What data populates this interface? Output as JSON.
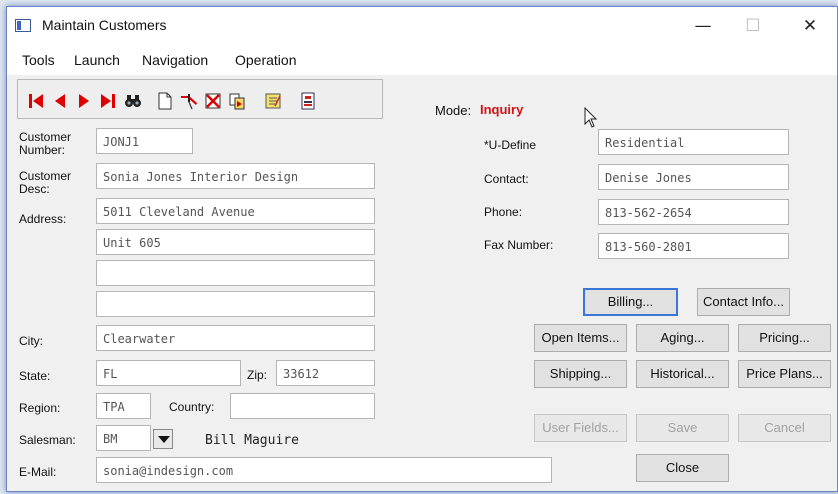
{
  "window": {
    "title": "Maintain Customers",
    "minimize": "—",
    "maximize": "☐",
    "close": "✕"
  },
  "menu": [
    "Tools",
    "Launch",
    "Navigation",
    "Operation"
  ],
  "toolbar_icons": [
    "first-record-icon",
    "previous-record-icon",
    "next-record-icon",
    "last-record-icon",
    "find-binoculars-icon",
    "new-record-icon",
    "pin-icon",
    "delete-icon",
    "copy-icon",
    "notes-icon",
    "report-icon"
  ],
  "mode": {
    "label": "Mode:",
    "value": "Inquiry",
    "color": "#d31212"
  },
  "labels": {
    "customer_number": "Customer Number:",
    "customer_desc": "Customer Desc:",
    "address": "Address:",
    "city": "City:",
    "state": "State:",
    "zip": "Zip:",
    "region": "Region:",
    "country": "Country:",
    "salesman": "Salesman:",
    "email": "E-Mail:",
    "udefine": "*U-Define",
    "contact": "Contact:",
    "phone": "Phone:",
    "fax": "Fax Number:"
  },
  "values": {
    "customer_number": "JONJ1",
    "customer_desc": "Sonia Jones Interior Design",
    "address1": "5011 Cleveland Avenue",
    "address2": "Unit 605",
    "address3": "",
    "address4": "",
    "city": "Clearwater",
    "state": "FL",
    "zip": "33612",
    "region": "TPA",
    "country": "",
    "salesman": "BM",
    "salesman_name": "Bill Maguire",
    "email": "sonia@indesign.com",
    "udefine": "Residential",
    "contact": "Denise Jones",
    "phone": "813-562-2654",
    "fax": "813-560-2801"
  },
  "buttons": {
    "billing": "Billing...",
    "contact_info": "Contact Info...",
    "open_items": "Open Items...",
    "aging": "Aging...",
    "pricing": "Pricing...",
    "shipping": "Shipping...",
    "historical": "Historical...",
    "price_plans": "Price Plans...",
    "user_fields": "User Fields...",
    "save": "Save",
    "cancel": "Cancel",
    "close": "Close"
  }
}
